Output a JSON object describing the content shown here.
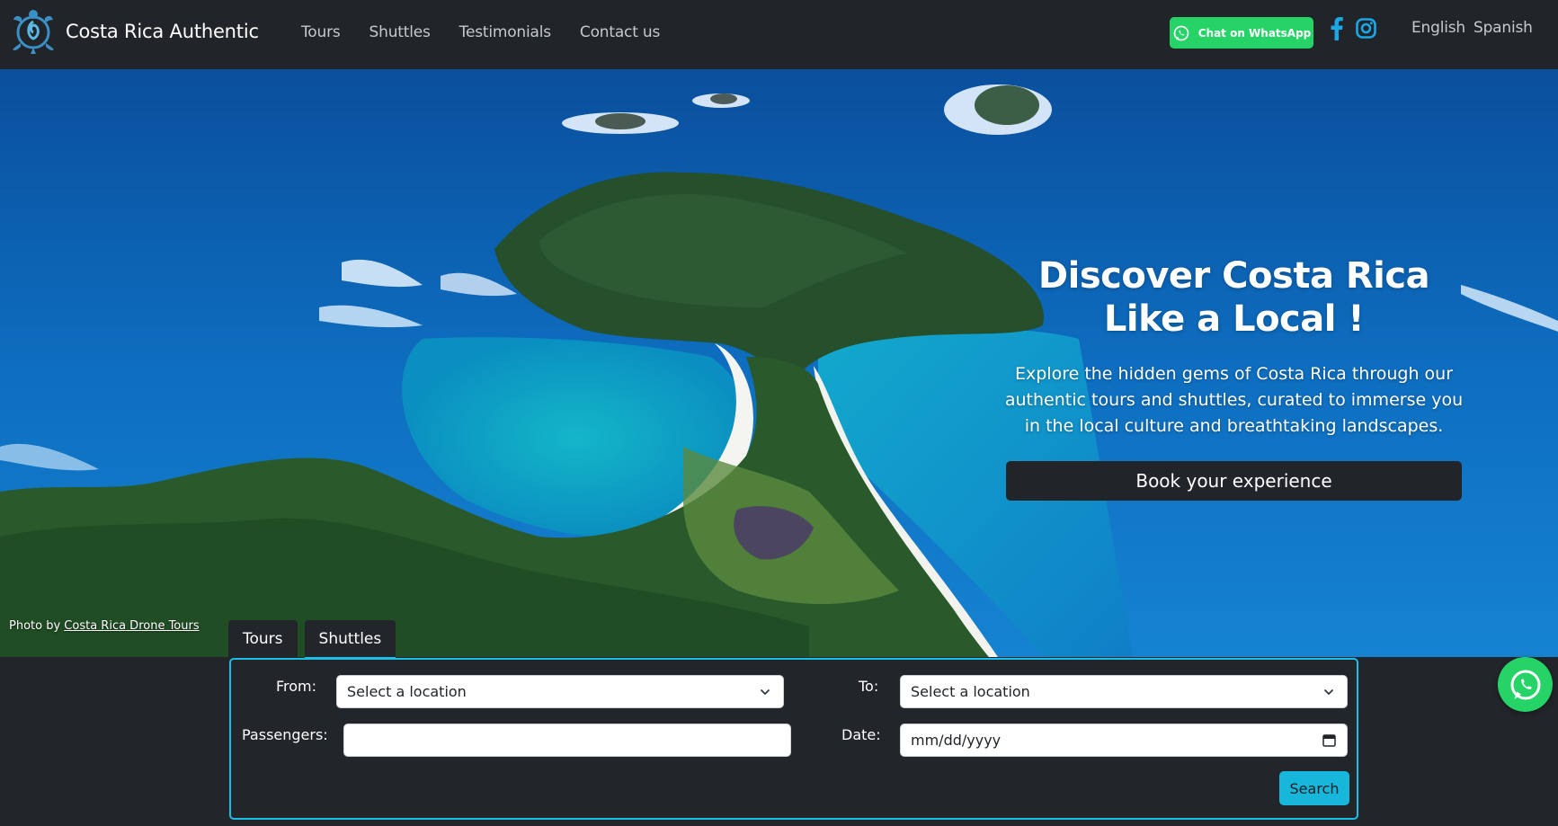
{
  "brand": {
    "name": "Costa Rica Authentic",
    "logo_icon": "turtle-logo-icon"
  },
  "nav": {
    "links": [
      "Tours",
      "Shuttles",
      "Testimonials",
      "Contact us"
    ]
  },
  "header": {
    "whatsapp_label": "Chat on WhatsApp",
    "languages": [
      "English",
      "Spanish"
    ]
  },
  "hero": {
    "title_line1": "Discover Costa Rica",
    "title_line2": "Like a Local !",
    "text": "Explore the hidden gems of Costa Rica through our authentic tours and shuttles, curated to immerse you in the local culture and breathtaking landscapes.",
    "cta_label": "Book your experience",
    "credit_prefix": "Photo by ",
    "credit_link": "Costa Rica Drone Tours"
  },
  "booking": {
    "tabs": [
      "Tours",
      "Shuttles"
    ],
    "active_tab": "Shuttles",
    "from_label": "From:",
    "from_value": "Select a location",
    "to_label": "To:",
    "to_value": "Select a location",
    "passengers_label": "Passengers:",
    "passengers_value": "",
    "date_label": "Date:",
    "date_placeholder": "mm/dd/yyyy",
    "search_label": "Search"
  },
  "colors": {
    "navbar": "#212529",
    "whatsapp": "#25d366",
    "accent": "#1ac0e8",
    "facebook": "#1ba7e6"
  }
}
